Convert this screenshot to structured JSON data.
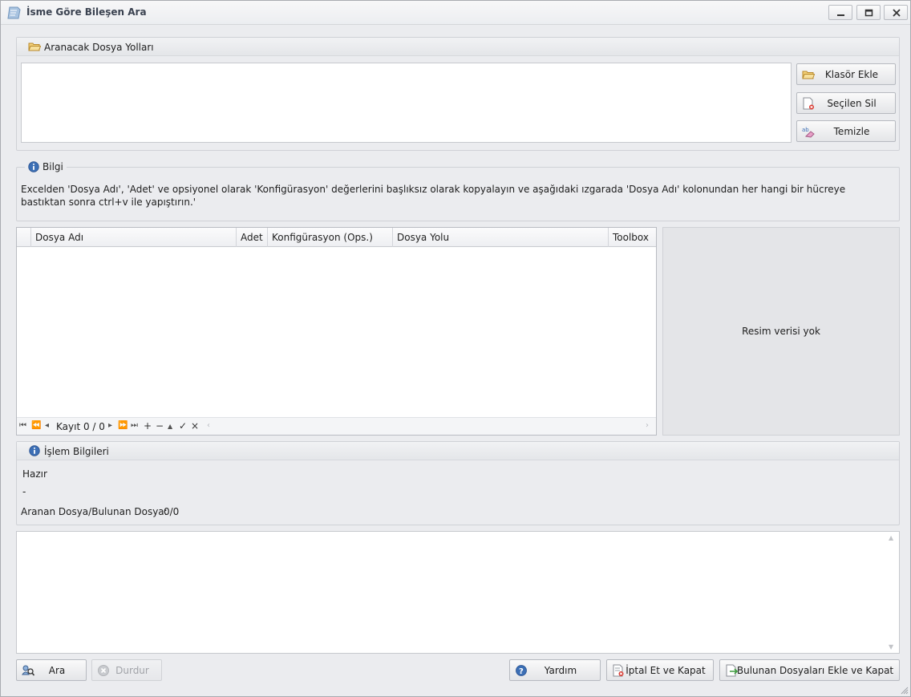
{
  "window": {
    "title": "İsme Göre Bileşen Ara",
    "icon": "document-search-icon"
  },
  "paths_group": {
    "header": "Aranacak Dosya Yolları",
    "buttons": {
      "add_folder": "Klasör Ekle",
      "remove_selected": "Seçilen Sil",
      "clear": "Temizle"
    }
  },
  "info_group": {
    "header": "Bilgi",
    "text": "Excelden 'Dosya Adı', 'Adet' ve opsiyonel olarak 'Konfigürasyon' değerlerini başlıksız olarak kopyalayın ve aşağıdaki ızgarada 'Dosya Adı' kolonundan her hangi bir hücreye bastıktan sonra ctrl+v ile yapıştırın.'"
  },
  "grid": {
    "columns": [
      "Dosya Adı",
      "Adet",
      "Konfigürasyon (Ops.)",
      "Dosya Yolu",
      "Toolbox"
    ],
    "navigator_text": "Kayıt 0 / 0"
  },
  "image_panel": {
    "empty_text": "Resim verisi yok"
  },
  "process_group": {
    "header": "İşlem Bilgileri",
    "status": "Hazır",
    "detail": "-",
    "count_label": "Aranan Dosya/Bulunan Dosya:",
    "count_value": "0/0"
  },
  "footer": {
    "search": "Ara",
    "stop": "Durdur",
    "help": "Yardım",
    "cancel_close": "İptal Et ve Kapat",
    "add_found_close": "Bulunan Dosyaları Ekle ve Kapat"
  },
  "colors": {
    "window_bg": "#ebecef",
    "border": "#cfd1d6",
    "folder_icon": "#e8b84a",
    "info_icon": "#3c6fb5",
    "disabled_text": "#a1a3a8"
  }
}
